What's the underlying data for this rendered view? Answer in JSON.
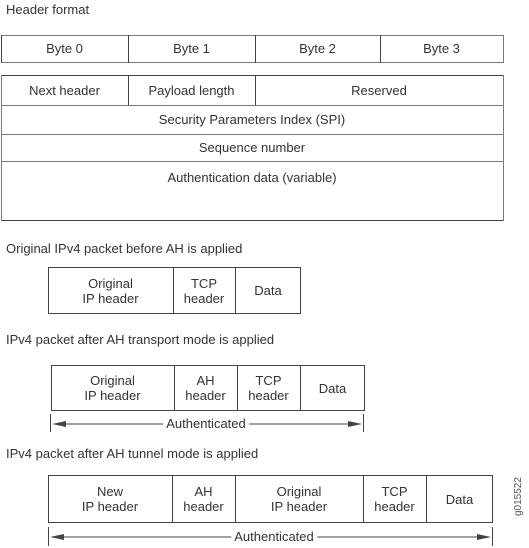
{
  "header_format": {
    "title": "Header format",
    "byte_row": [
      "Byte 0",
      "Byte 1",
      "Byte 2",
      "Byte 3"
    ],
    "fields": {
      "next_header": "Next header",
      "payload_length": "Payload length",
      "reserved": "Reserved",
      "spi": "Security Parameters Index (SPI)",
      "sequence_number": "Sequence number",
      "authentication_data": "Authentication data (variable)"
    }
  },
  "original_packet": {
    "title": "Original IPv4 packet before AH is applied",
    "cells": [
      {
        "line1": "Original",
        "line2": "IP header"
      },
      {
        "line1": "TCP",
        "line2": "header"
      },
      {
        "line1": "Data",
        "line2": ""
      }
    ]
  },
  "transport_mode": {
    "title": "IPv4 packet after AH transport mode is applied",
    "cells": [
      {
        "line1": "Original",
        "line2": "IP header"
      },
      {
        "line1": "AH",
        "line2": "header"
      },
      {
        "line1": "TCP",
        "line2": "header"
      },
      {
        "line1": "Data",
        "line2": ""
      }
    ],
    "span_label": "Authenticated"
  },
  "tunnel_mode": {
    "title": "IPv4 packet after AH tunnel mode is applied",
    "cells": [
      {
        "line1": "New",
        "line2": "IP header"
      },
      {
        "line1": "AH",
        "line2": "header"
      },
      {
        "line1": "Original",
        "line2": "IP header"
      },
      {
        "line1": "TCP",
        "line2": "header"
      },
      {
        "line1": "Data",
        "line2": ""
      }
    ],
    "span_label": "Authenticated"
  },
  "figure_id": "g015522"
}
